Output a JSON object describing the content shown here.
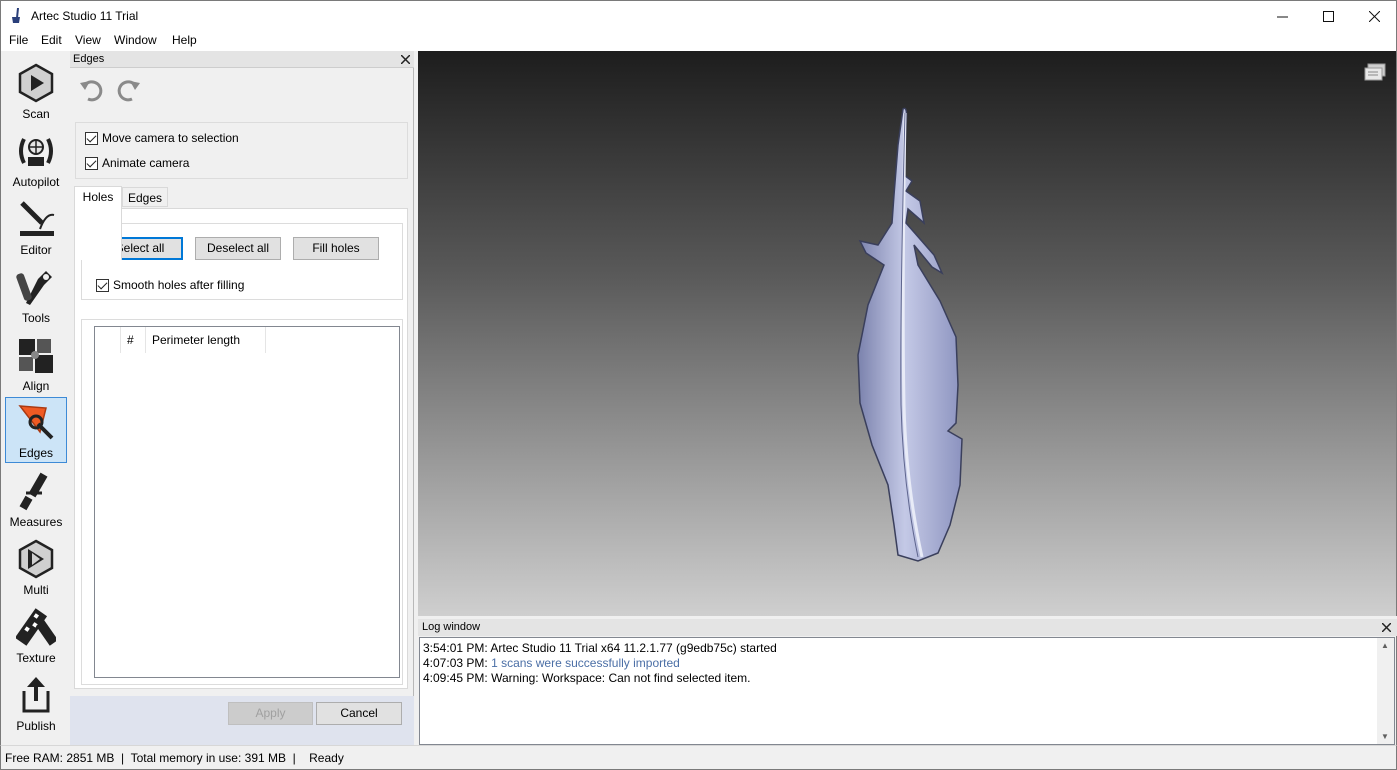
{
  "window": {
    "title": "Artec Studio 11 Trial"
  },
  "menu": [
    "File",
    "Edit",
    "View",
    "Window",
    "Help"
  ],
  "toolbar": [
    {
      "label": "Scan",
      "icon": "scan-icon"
    },
    {
      "label": "Autopilot",
      "icon": "autopilot-icon"
    },
    {
      "label": "Editor",
      "icon": "editor-icon"
    },
    {
      "label": "Tools",
      "icon": "tools-icon"
    },
    {
      "label": "Align",
      "icon": "align-icon"
    },
    {
      "label": "Edges",
      "icon": "edges-icon",
      "active": true
    },
    {
      "label": "Measures",
      "icon": "measures-icon"
    },
    {
      "label": "Multi",
      "icon": "multi-icon"
    },
    {
      "label": "Texture",
      "icon": "texture-icon"
    },
    {
      "label": "Publish",
      "icon": "publish-icon"
    }
  ],
  "panel": {
    "title": "Edges",
    "options": {
      "move_camera": {
        "label": "Move camera to selection",
        "checked": true
      },
      "animate_camera": {
        "label": "Animate camera",
        "checked": true
      }
    },
    "tabs": [
      {
        "label": "Holes",
        "active": true
      },
      {
        "label": "Edges",
        "active": false
      }
    ],
    "holes": {
      "select_all": "Select all",
      "deselect_all": "Deselect all",
      "fill_holes": "Fill holes",
      "smooth": {
        "label": "Smooth holes after filling",
        "checked": true
      },
      "table": {
        "columns": [
          "",
          "#",
          "Perimeter length"
        ],
        "rows": []
      }
    },
    "footer": {
      "apply": "Apply",
      "cancel": "Cancel"
    }
  },
  "log": {
    "title": "Log window",
    "lines": [
      {
        "time": "3:54:01 PM:",
        "text": "Artec Studio 11 Trial x64 11.2.1.77 (g9edb75c) started"
      },
      {
        "time": "4:07:03 PM:",
        "text": "1 scans were successfully imported"
      },
      {
        "time": "4:09:45 PM:",
        "text": "Warning: Workspace: Can not find selected item."
      }
    ]
  },
  "status": {
    "text": "Free RAM: 2851 MB  |  Total memory in use: 391 MB  |    Ready"
  },
  "colors": {
    "accent": "#0078d7",
    "active_tool_bg": "#cce4f7",
    "feather": "#a6acd0",
    "log_highlight": "#4b6fa6"
  }
}
